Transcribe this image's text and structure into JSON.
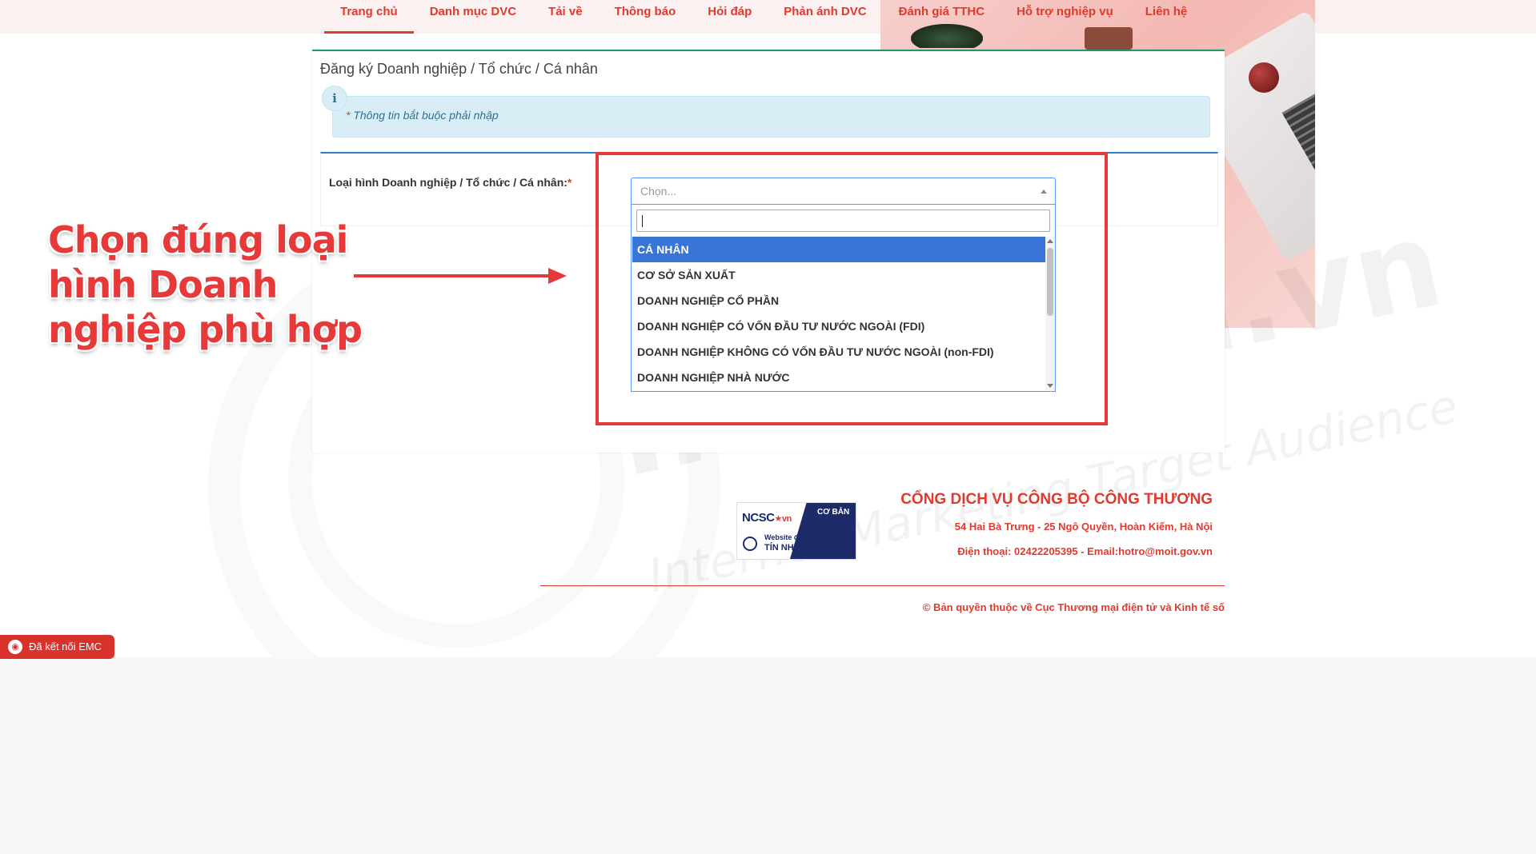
{
  "nav": {
    "items": [
      {
        "label": "Trang chủ",
        "active": true
      },
      {
        "label": "Danh mục DVC",
        "active": false
      },
      {
        "label": "Tải về",
        "active": false
      },
      {
        "label": "Thông báo",
        "active": false
      },
      {
        "label": "Hỏi đáp",
        "active": false
      },
      {
        "label": "Phản ánh DVC",
        "active": false
      },
      {
        "label": "Đánh giá TTHC",
        "active": false
      },
      {
        "label": "Hỗ trợ nghiệp vụ",
        "active": false
      },
      {
        "label": "Liên hệ",
        "active": false
      }
    ]
  },
  "panel": {
    "breadcrumb": "Đăng ký Doanh nghiệp / Tổ chức / Cá nhân",
    "alert_icon": "i",
    "alert_required_mark": "*",
    "alert_text": " Thông tin bắt buộc phải nhập"
  },
  "form": {
    "type_label": "Loại hình Doanh nghiệp / Tổ chức / Cá nhân:",
    "required_mark": "*",
    "select_placeholder": "Chọn...",
    "search_value": "",
    "options": [
      {
        "label": "CÁ NHÂN",
        "selected": true
      },
      {
        "label": "CƠ SỞ SẢN XUẤT",
        "selected": false
      },
      {
        "label": "DOANH NGHIỆP CỔ PHẦN",
        "selected": false
      },
      {
        "label": "DOANH NGHIỆP CÓ VỐN ĐẦU TƯ NƯỚC NGOÀI (FDI)",
        "selected": false
      },
      {
        "label": "DOANH NGHIỆP KHÔNG CÓ VỐN ĐẦU TƯ NƯỚC NGOÀI (non-FDI)",
        "selected": false
      },
      {
        "label": "DOANH NGHIỆP NHÀ NƯỚC",
        "selected": false
      }
    ]
  },
  "annotation": {
    "callout_text": "Chọn đúng loại hình Doanh nghiệp phù hợp",
    "color": "#e5393a"
  },
  "watermark": {
    "text": "IMTA.edu.vn",
    "subtext": "Internet Marketing Target Audience"
  },
  "footer": {
    "badge_ncsc": "NCSC",
    "badge_vn": "vn",
    "badge_level": "CƠ BẢN",
    "badge_website": "Website đạt chứng nhận",
    "badge_trust": "TÍN NHIỆM MẠNG",
    "title": "CỔNG DỊCH VỤ CÔNG BỘ CÔNG THƯƠNG",
    "address": "54 Hai Bà Trưng - 25 Ngô Quyền, Hoàn Kiếm, Hà Nội",
    "phone_email": "Điện thoại: 02422205395 - Email:hotro@moit.gov.vn",
    "copyright": "© Bản quyền thuộc về Cục Thương mại điện tử và Kinh tế số",
    "emc_label": "Đã kết nối EMC"
  },
  "colors": {
    "brand_red": "#e03a2f",
    "select_blue": "#3875d7",
    "alert_bg": "#d9edf7"
  }
}
